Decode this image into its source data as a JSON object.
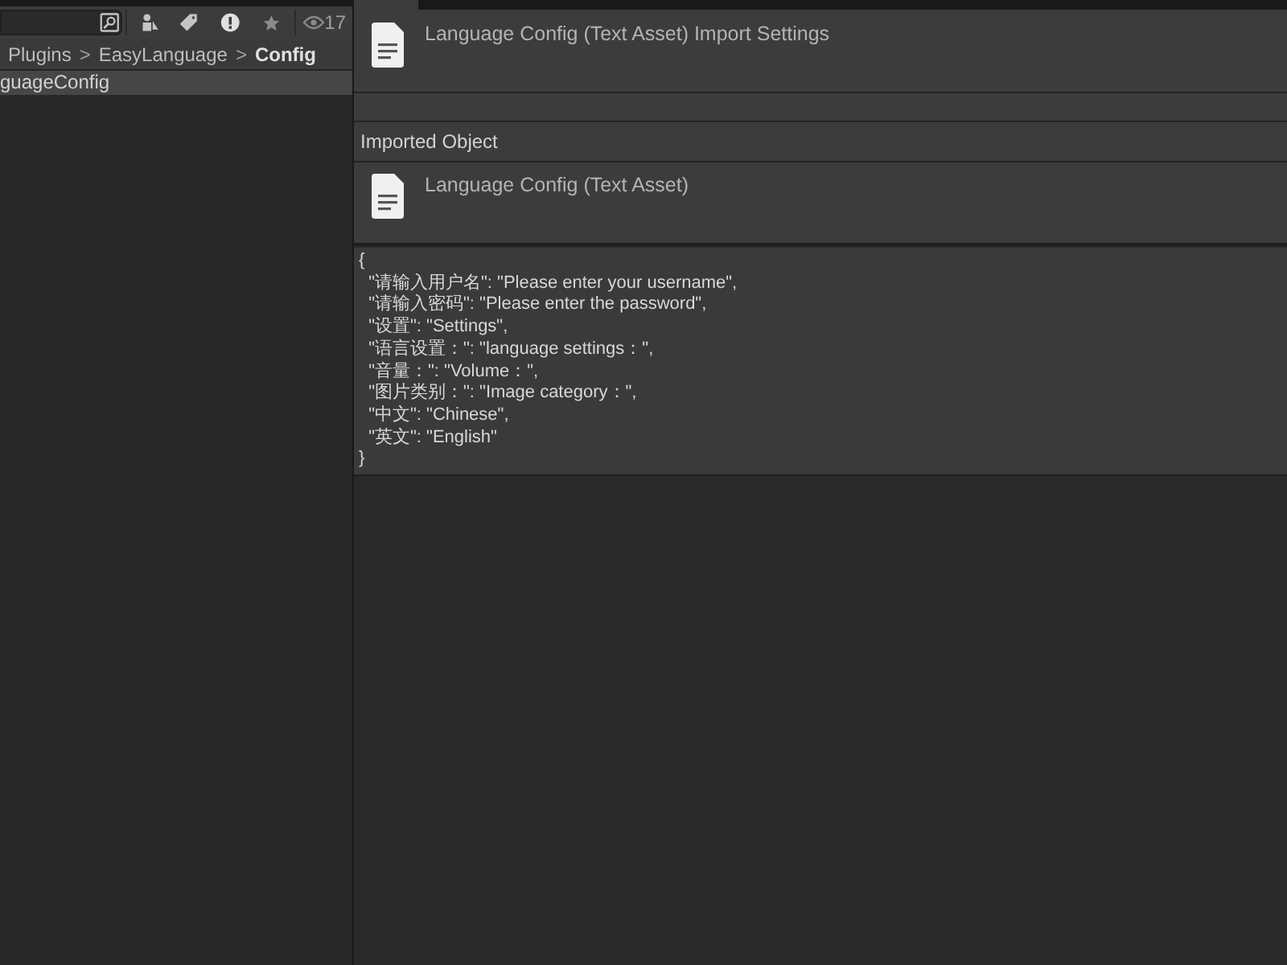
{
  "project": {
    "toolbar": {
      "visible_count": "17"
    },
    "breadcrumb": [
      {
        "label": "Plugins",
        "current": false
      },
      {
        "label": "EasyLanguage",
        "current": false
      },
      {
        "label": "Config",
        "current": true
      }
    ],
    "separator": ">",
    "items": [
      {
        "label": "guageConfig",
        "selected": true
      }
    ]
  },
  "inspector": {
    "header_title": "Language Config (Text Asset) Import Settings",
    "section_title": "Imported Object",
    "object_title": "Language Config (Text Asset)",
    "text_lines": [
      "{",
      "  \"请输入用户名\": \"Please enter your username\",",
      "  \"请输入密码\": \"Please enter the password\",",
      "  \"设置\": \"Settings\",",
      "  \"语言设置：\": \"language settings：\",",
      "  \"音量：\": \"Volume：\",",
      "  \"图片类别：\": \"Image category：\",",
      "  \"中文\": \"Chinese\",",
      "  \"英文\": \"English\"",
      "}"
    ]
  }
}
